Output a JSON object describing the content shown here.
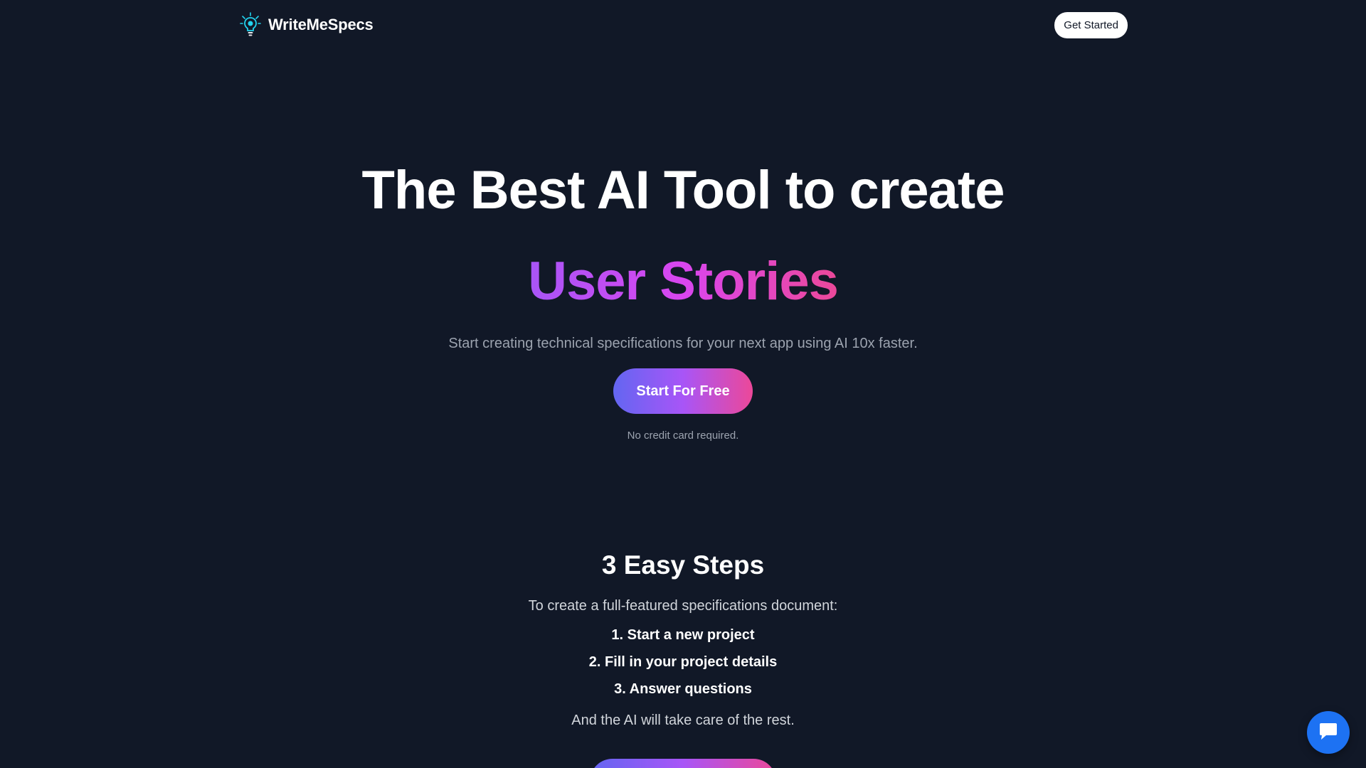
{
  "header": {
    "brand_name": "WriteMeSpecs",
    "logo_icon": "lightbulb-icon",
    "get_started_label": "Get Started"
  },
  "hero": {
    "title": "The Best AI Tool to create",
    "highlight": "User Stories",
    "subtitle": "Start creating technical specifications for your next app using AI 10x faster.",
    "cta_label": "Start For Free",
    "cta_note": "No credit card required."
  },
  "steps": {
    "title": "3 Easy Steps",
    "intro": "To create a full-featured specifications document:",
    "items": [
      "1. Start a new project",
      "2. Fill in your project details",
      "3. Answer questions"
    ],
    "outro": "And the AI will take care of the rest."
  },
  "chat": {
    "icon": "chat-bubble-icon"
  },
  "colors": {
    "background": "#111827",
    "accent_start": "#6366f1",
    "accent_mid": "#a855f7",
    "accent_end": "#ec4899",
    "chat_button": "#1d72f3",
    "logo_accent": "#22d3ee"
  }
}
